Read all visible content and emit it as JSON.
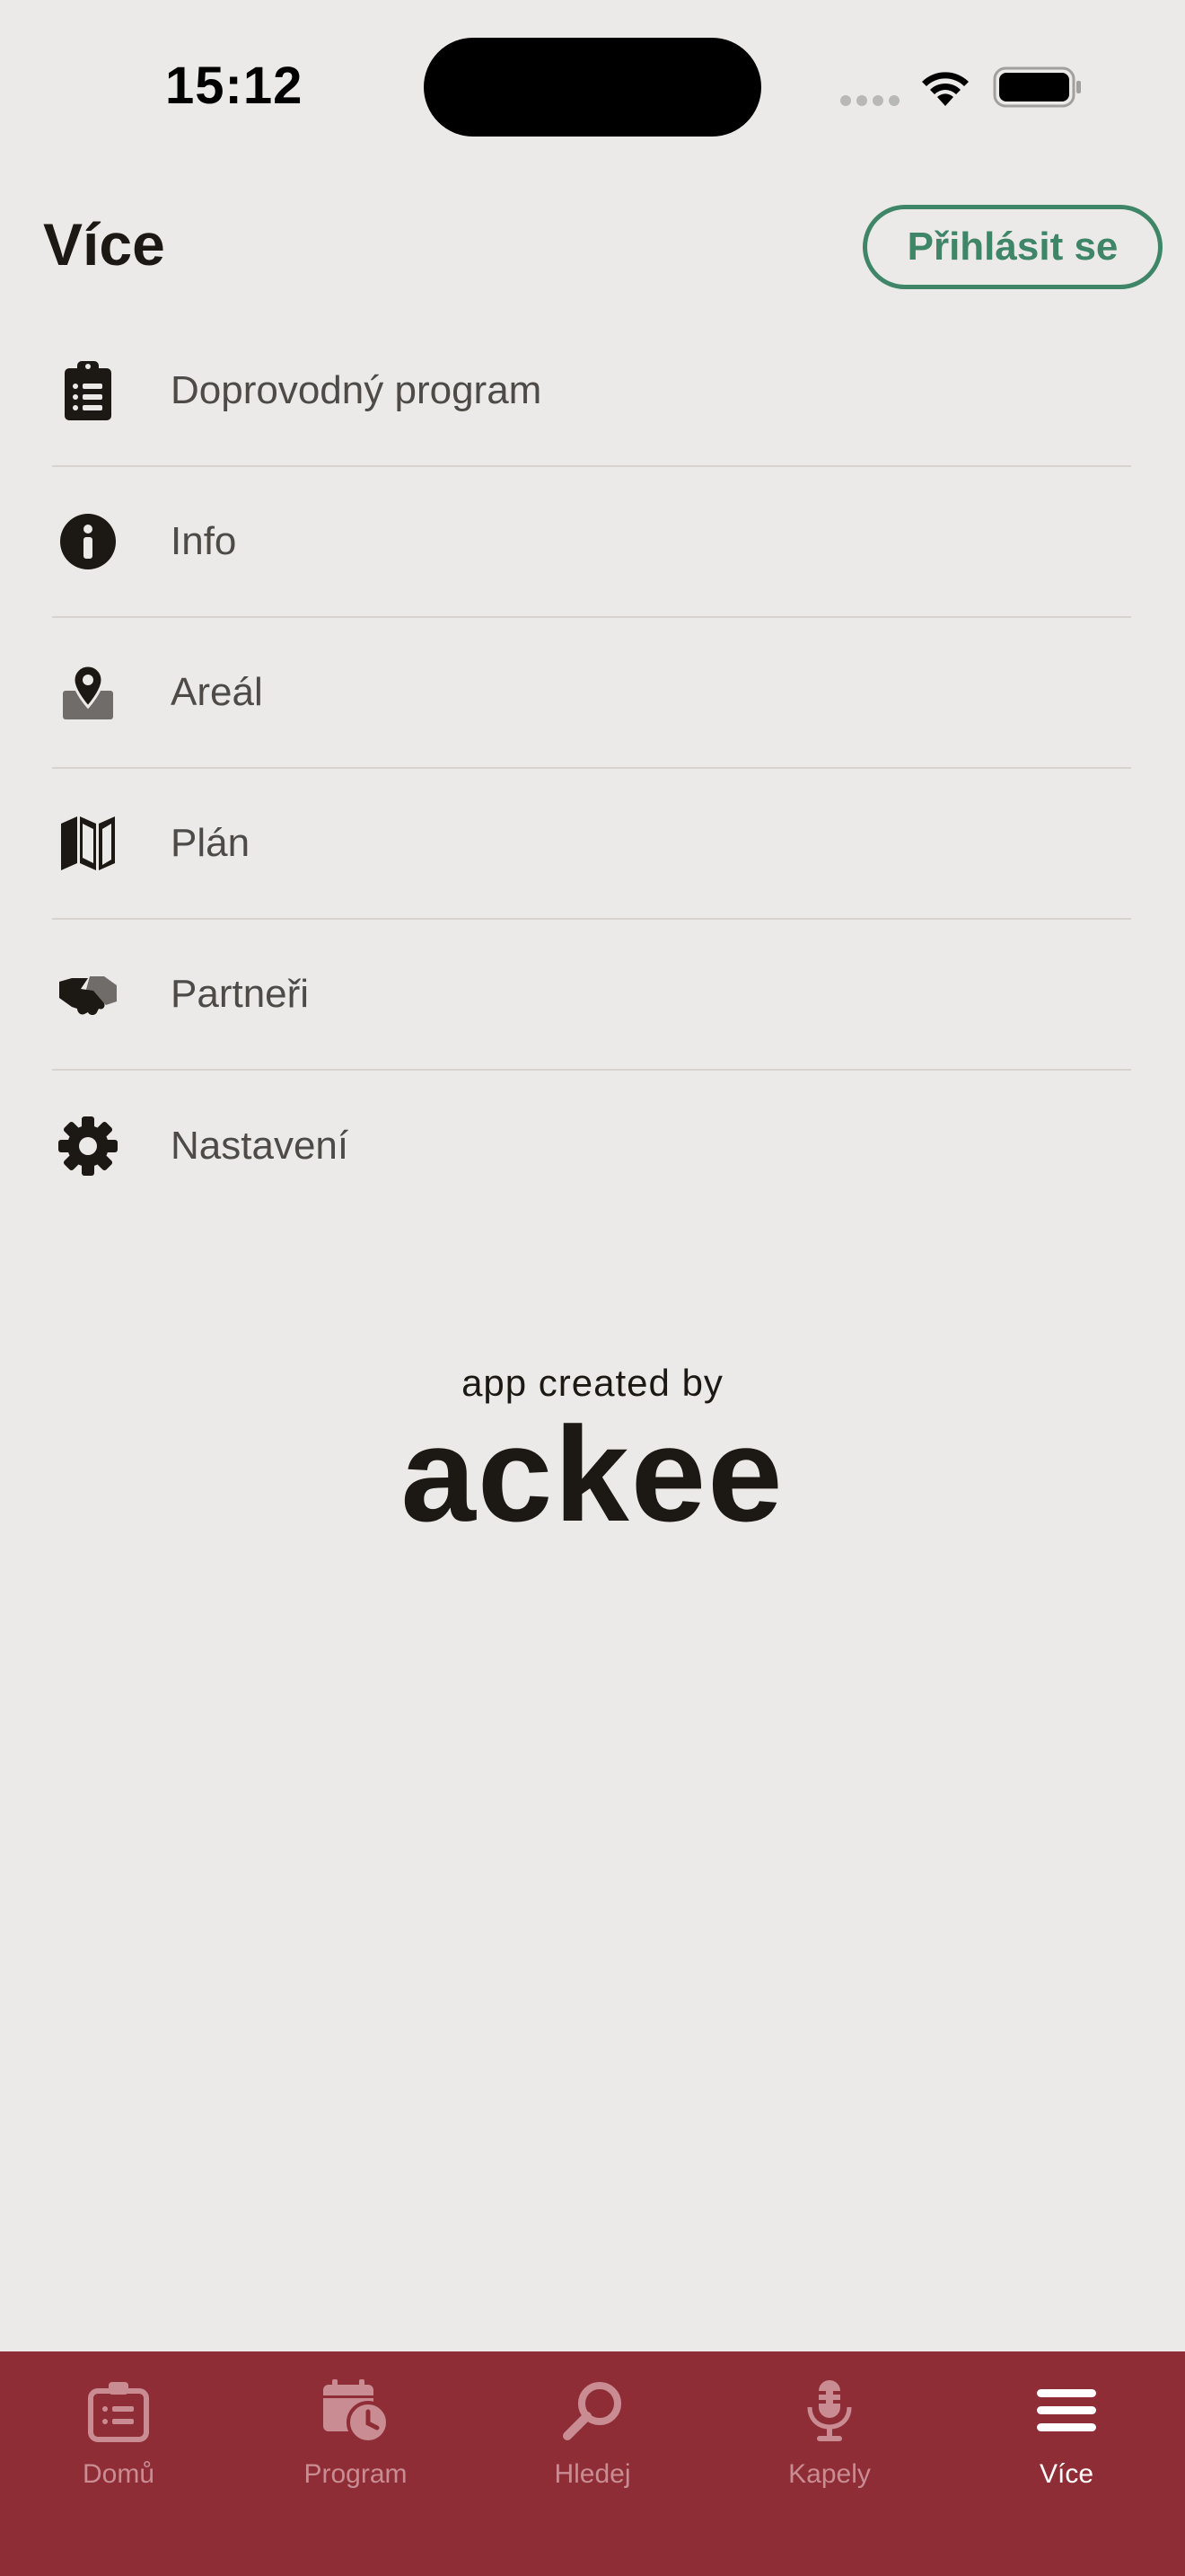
{
  "status_bar": {
    "time": "15:12"
  },
  "header": {
    "title": "Více",
    "login_label": "Přihlásit se"
  },
  "menu": {
    "items": [
      {
        "label": "Doprovodný program",
        "icon": "clipboard-list-icon"
      },
      {
        "label": "Info",
        "icon": "info-circle-icon"
      },
      {
        "label": "Areál",
        "icon": "map-pin-icon"
      },
      {
        "label": "Plán",
        "icon": "folded-map-icon"
      },
      {
        "label": "Partneři",
        "icon": "handshake-icon"
      },
      {
        "label": "Nastavení",
        "icon": "gear-icon"
      }
    ]
  },
  "credit": {
    "caption": "app created by",
    "logo": "ackee"
  },
  "tab_bar": {
    "tabs": [
      {
        "label": "Domů",
        "icon": "home-list-icon",
        "active": false
      },
      {
        "label": "Program",
        "icon": "calendar-clock-icon",
        "active": false
      },
      {
        "label": "Hledej",
        "icon": "search-icon",
        "active": false
      },
      {
        "label": "Kapely",
        "icon": "microphone-icon",
        "active": false
      },
      {
        "label": "Více",
        "icon": "hamburger-menu-icon",
        "active": true
      }
    ]
  },
  "colors": {
    "background": "#ECEAE8",
    "accent_green": "#3f8568",
    "tab_bar": "#8e2d36",
    "tab_inactive": "#c98c92",
    "tab_active": "#ffffff"
  }
}
